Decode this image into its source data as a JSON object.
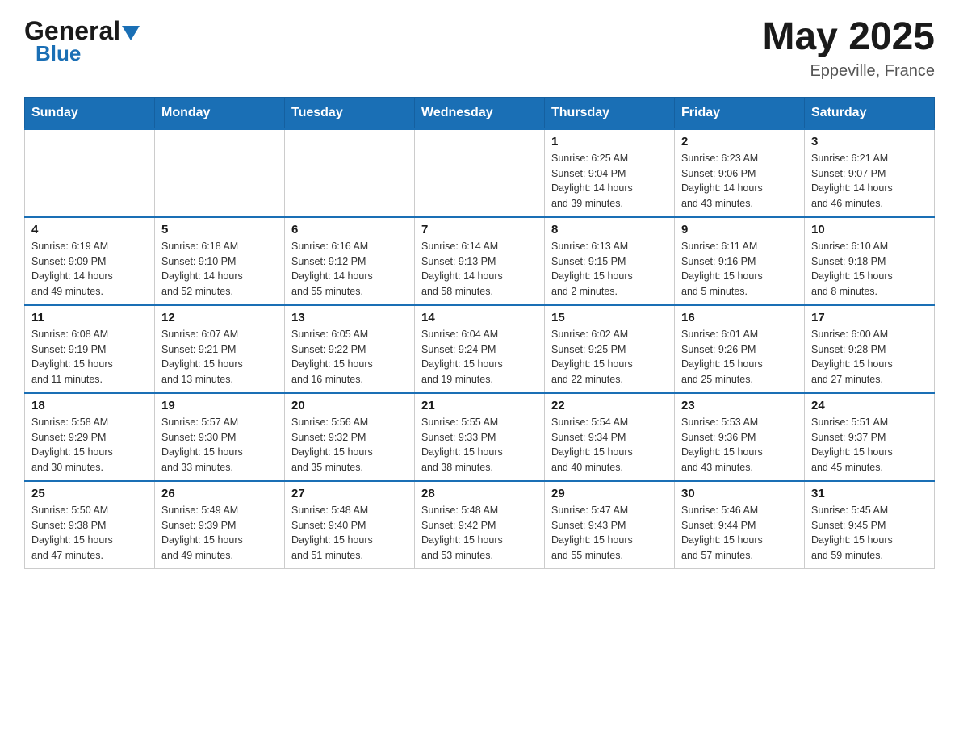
{
  "header": {
    "logo_general": "General",
    "logo_blue": "Blue",
    "month_year": "May 2025",
    "location": "Eppeville, France"
  },
  "days_of_week": [
    "Sunday",
    "Monday",
    "Tuesday",
    "Wednesday",
    "Thursday",
    "Friday",
    "Saturday"
  ],
  "weeks": [
    {
      "days": [
        {
          "number": "",
          "info": ""
        },
        {
          "number": "",
          "info": ""
        },
        {
          "number": "",
          "info": ""
        },
        {
          "number": "",
          "info": ""
        },
        {
          "number": "1",
          "info": "Sunrise: 6:25 AM\nSunset: 9:04 PM\nDaylight: 14 hours\nand 39 minutes."
        },
        {
          "number": "2",
          "info": "Sunrise: 6:23 AM\nSunset: 9:06 PM\nDaylight: 14 hours\nand 43 minutes."
        },
        {
          "number": "3",
          "info": "Sunrise: 6:21 AM\nSunset: 9:07 PM\nDaylight: 14 hours\nand 46 minutes."
        }
      ]
    },
    {
      "days": [
        {
          "number": "4",
          "info": "Sunrise: 6:19 AM\nSunset: 9:09 PM\nDaylight: 14 hours\nand 49 minutes."
        },
        {
          "number": "5",
          "info": "Sunrise: 6:18 AM\nSunset: 9:10 PM\nDaylight: 14 hours\nand 52 minutes."
        },
        {
          "number": "6",
          "info": "Sunrise: 6:16 AM\nSunset: 9:12 PM\nDaylight: 14 hours\nand 55 minutes."
        },
        {
          "number": "7",
          "info": "Sunrise: 6:14 AM\nSunset: 9:13 PM\nDaylight: 14 hours\nand 58 minutes."
        },
        {
          "number": "8",
          "info": "Sunrise: 6:13 AM\nSunset: 9:15 PM\nDaylight: 15 hours\nand 2 minutes."
        },
        {
          "number": "9",
          "info": "Sunrise: 6:11 AM\nSunset: 9:16 PM\nDaylight: 15 hours\nand 5 minutes."
        },
        {
          "number": "10",
          "info": "Sunrise: 6:10 AM\nSunset: 9:18 PM\nDaylight: 15 hours\nand 8 minutes."
        }
      ]
    },
    {
      "days": [
        {
          "number": "11",
          "info": "Sunrise: 6:08 AM\nSunset: 9:19 PM\nDaylight: 15 hours\nand 11 minutes."
        },
        {
          "number": "12",
          "info": "Sunrise: 6:07 AM\nSunset: 9:21 PM\nDaylight: 15 hours\nand 13 minutes."
        },
        {
          "number": "13",
          "info": "Sunrise: 6:05 AM\nSunset: 9:22 PM\nDaylight: 15 hours\nand 16 minutes."
        },
        {
          "number": "14",
          "info": "Sunrise: 6:04 AM\nSunset: 9:24 PM\nDaylight: 15 hours\nand 19 minutes."
        },
        {
          "number": "15",
          "info": "Sunrise: 6:02 AM\nSunset: 9:25 PM\nDaylight: 15 hours\nand 22 minutes."
        },
        {
          "number": "16",
          "info": "Sunrise: 6:01 AM\nSunset: 9:26 PM\nDaylight: 15 hours\nand 25 minutes."
        },
        {
          "number": "17",
          "info": "Sunrise: 6:00 AM\nSunset: 9:28 PM\nDaylight: 15 hours\nand 27 minutes."
        }
      ]
    },
    {
      "days": [
        {
          "number": "18",
          "info": "Sunrise: 5:58 AM\nSunset: 9:29 PM\nDaylight: 15 hours\nand 30 minutes."
        },
        {
          "number": "19",
          "info": "Sunrise: 5:57 AM\nSunset: 9:30 PM\nDaylight: 15 hours\nand 33 minutes."
        },
        {
          "number": "20",
          "info": "Sunrise: 5:56 AM\nSunset: 9:32 PM\nDaylight: 15 hours\nand 35 minutes."
        },
        {
          "number": "21",
          "info": "Sunrise: 5:55 AM\nSunset: 9:33 PM\nDaylight: 15 hours\nand 38 minutes."
        },
        {
          "number": "22",
          "info": "Sunrise: 5:54 AM\nSunset: 9:34 PM\nDaylight: 15 hours\nand 40 minutes."
        },
        {
          "number": "23",
          "info": "Sunrise: 5:53 AM\nSunset: 9:36 PM\nDaylight: 15 hours\nand 43 minutes."
        },
        {
          "number": "24",
          "info": "Sunrise: 5:51 AM\nSunset: 9:37 PM\nDaylight: 15 hours\nand 45 minutes."
        }
      ]
    },
    {
      "days": [
        {
          "number": "25",
          "info": "Sunrise: 5:50 AM\nSunset: 9:38 PM\nDaylight: 15 hours\nand 47 minutes."
        },
        {
          "number": "26",
          "info": "Sunrise: 5:49 AM\nSunset: 9:39 PM\nDaylight: 15 hours\nand 49 minutes."
        },
        {
          "number": "27",
          "info": "Sunrise: 5:48 AM\nSunset: 9:40 PM\nDaylight: 15 hours\nand 51 minutes."
        },
        {
          "number": "28",
          "info": "Sunrise: 5:48 AM\nSunset: 9:42 PM\nDaylight: 15 hours\nand 53 minutes."
        },
        {
          "number": "29",
          "info": "Sunrise: 5:47 AM\nSunset: 9:43 PM\nDaylight: 15 hours\nand 55 minutes."
        },
        {
          "number": "30",
          "info": "Sunrise: 5:46 AM\nSunset: 9:44 PM\nDaylight: 15 hours\nand 57 minutes."
        },
        {
          "number": "31",
          "info": "Sunrise: 5:45 AM\nSunset: 9:45 PM\nDaylight: 15 hours\nand 59 minutes."
        }
      ]
    }
  ]
}
